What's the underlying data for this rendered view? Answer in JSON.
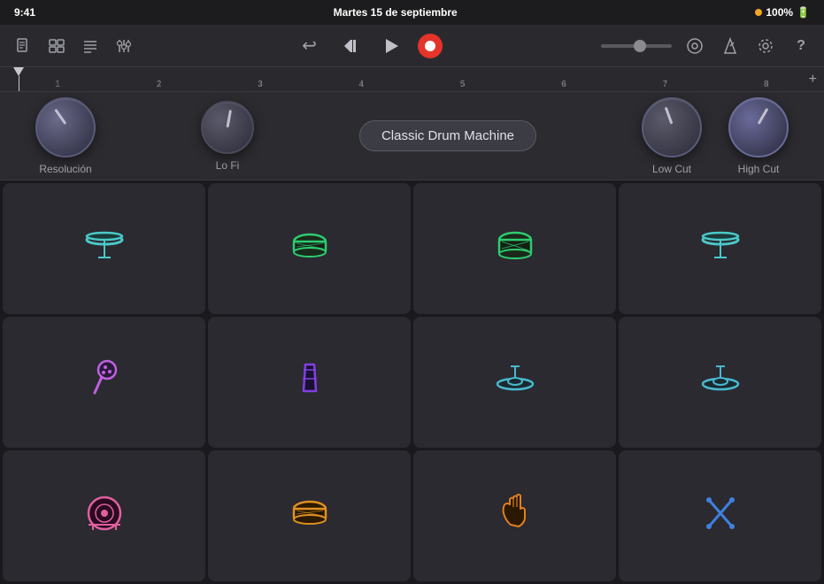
{
  "statusBar": {
    "time": "9:41",
    "date": "Martes 15 de septiembre",
    "battery": "100%",
    "batteryIcon": "🔋"
  },
  "toolbar": {
    "leftIcons": [
      "document-icon",
      "layers-icon",
      "list-icon",
      "mixer-icon"
    ],
    "undoLabel": "↩",
    "skipBackLabel": "⏮",
    "playLabel": "▶",
    "recordLabel": "●",
    "metronomeLabel": "△",
    "settingsLabel": "⚙",
    "helpLabel": "?"
  },
  "controls": {
    "knob1Label": "Resolución",
    "knob2Label": "Lo Fi",
    "instrumentName": "Classic Drum Machine",
    "knob3Label": "Low Cut",
    "knob4Label": "High Cut"
  },
  "pads": [
    {
      "id": "pad-1",
      "icon": "hihat",
      "color": "#4ac8c8",
      "label": "Hi-Hat"
    },
    {
      "id": "pad-2",
      "icon": "snare",
      "color": "#2ecc71",
      "label": "Snare 1"
    },
    {
      "id": "pad-3",
      "icon": "snare2",
      "color": "#2ecc71",
      "label": "Snare 2"
    },
    {
      "id": "pad-4",
      "icon": "hihat2",
      "color": "#4ac8c8",
      "label": "Hi-Hat 2"
    },
    {
      "id": "pad-5",
      "icon": "maraca",
      "color": "#c060e0",
      "label": "Maraca"
    },
    {
      "id": "pad-6",
      "icon": "cowbell",
      "color": "#8040e0",
      "label": "Cowbell"
    },
    {
      "id": "pad-7",
      "icon": "cymbal1",
      "color": "#4ab8d0",
      "label": "Cymbal 1"
    },
    {
      "id": "pad-8",
      "icon": "cymbal2",
      "color": "#4ab8d0",
      "label": "Cymbal 2"
    },
    {
      "id": "pad-9",
      "icon": "kick",
      "color": "#e060a0",
      "label": "Kick"
    },
    {
      "id": "pad-10",
      "icon": "snare3",
      "color": "#e09020",
      "label": "Snare 3"
    },
    {
      "id": "pad-11",
      "icon": "hand",
      "color": "#e08020",
      "label": "Hand"
    },
    {
      "id": "pad-12",
      "icon": "cross",
      "color": "#4080e0",
      "label": "Cross Sticks"
    }
  ],
  "rulerMarks": [
    "1",
    "2",
    "3",
    "4",
    "5",
    "6",
    "7",
    "8"
  ]
}
